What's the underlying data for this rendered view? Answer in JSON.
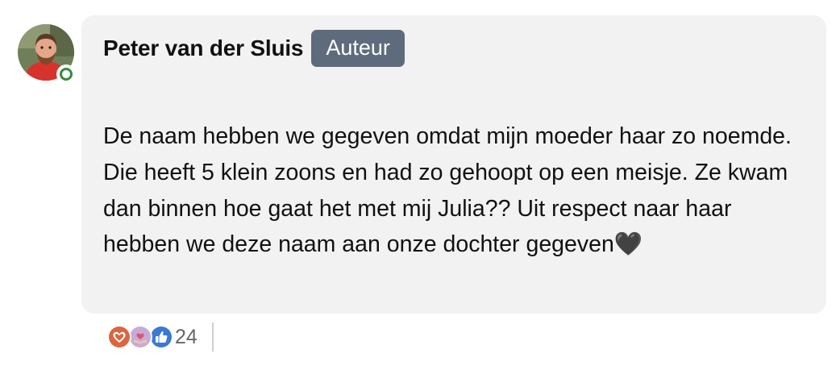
{
  "comment": {
    "author": {
      "name": "Peter van der Sluis",
      "badge": "Auteur",
      "online": true
    },
    "text": "De naam hebben we gegeven omdat mijn moeder haar zo noemde. Die heeft 5 klein zoons en had zo gehoopt op een meisje. Ze kwam dan binnen hoe gaat het met mij Julia?? Uit respect naar haar hebben we deze naam aan onze dochter gegeven🖤",
    "reactions": {
      "icons": [
        "heart-reaction-icon",
        "celebrate-reaction-icon",
        "like-reaction-icon"
      ],
      "count": "24"
    }
  },
  "colors": {
    "bubble_background": "#f2f2f2",
    "badge_background": "#5e6b7d",
    "presence_green": "#3a8a3f",
    "text": "#111111",
    "muted_text": "#666666"
  }
}
